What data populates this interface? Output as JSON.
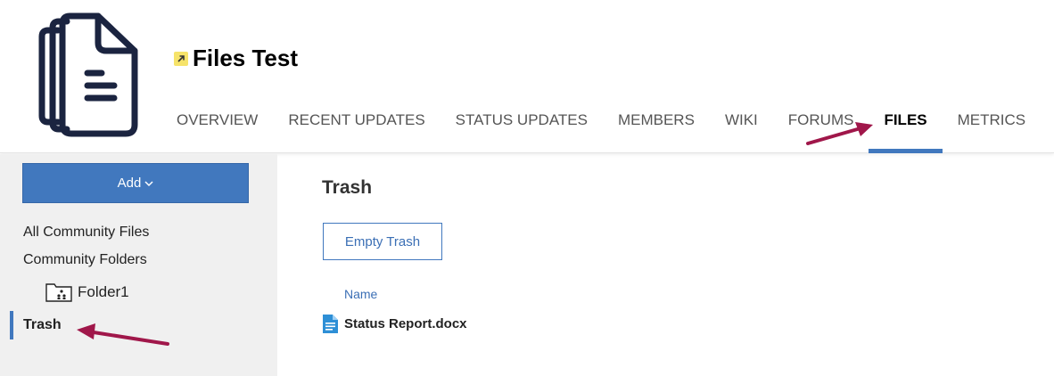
{
  "community": {
    "title": "Files Test"
  },
  "nav": {
    "items": [
      {
        "label": "OVERVIEW",
        "active": false
      },
      {
        "label": "RECENT UPDATES",
        "active": false
      },
      {
        "label": "STATUS UPDATES",
        "active": false
      },
      {
        "label": "MEMBERS",
        "active": false
      },
      {
        "label": "WIKI",
        "active": false
      },
      {
        "label": "FORUMS",
        "active": false
      },
      {
        "label": "FILES",
        "active": true
      },
      {
        "label": "METRICS",
        "active": false
      }
    ]
  },
  "sidebar": {
    "add_label": "Add",
    "all_files": "All Community Files",
    "folders": "Community Folders",
    "folder1": "Folder1",
    "trash": "Trash"
  },
  "main": {
    "title": "Trash",
    "empty_trash_label": "Empty Trash",
    "column_name": "Name",
    "files": [
      {
        "name": "Status Report.docx"
      }
    ]
  },
  "colors": {
    "accent": "#4178be",
    "annotation_arrow": "#a0174a",
    "external_badge": "#f6e36a",
    "doc_icon": "#2e8fd6"
  },
  "icons": {
    "logo": "files-stack-icon",
    "external": "external-link-icon",
    "add_chevron": "chevron-down-icon",
    "folder": "shared-folder-icon",
    "file": "document-icon"
  }
}
